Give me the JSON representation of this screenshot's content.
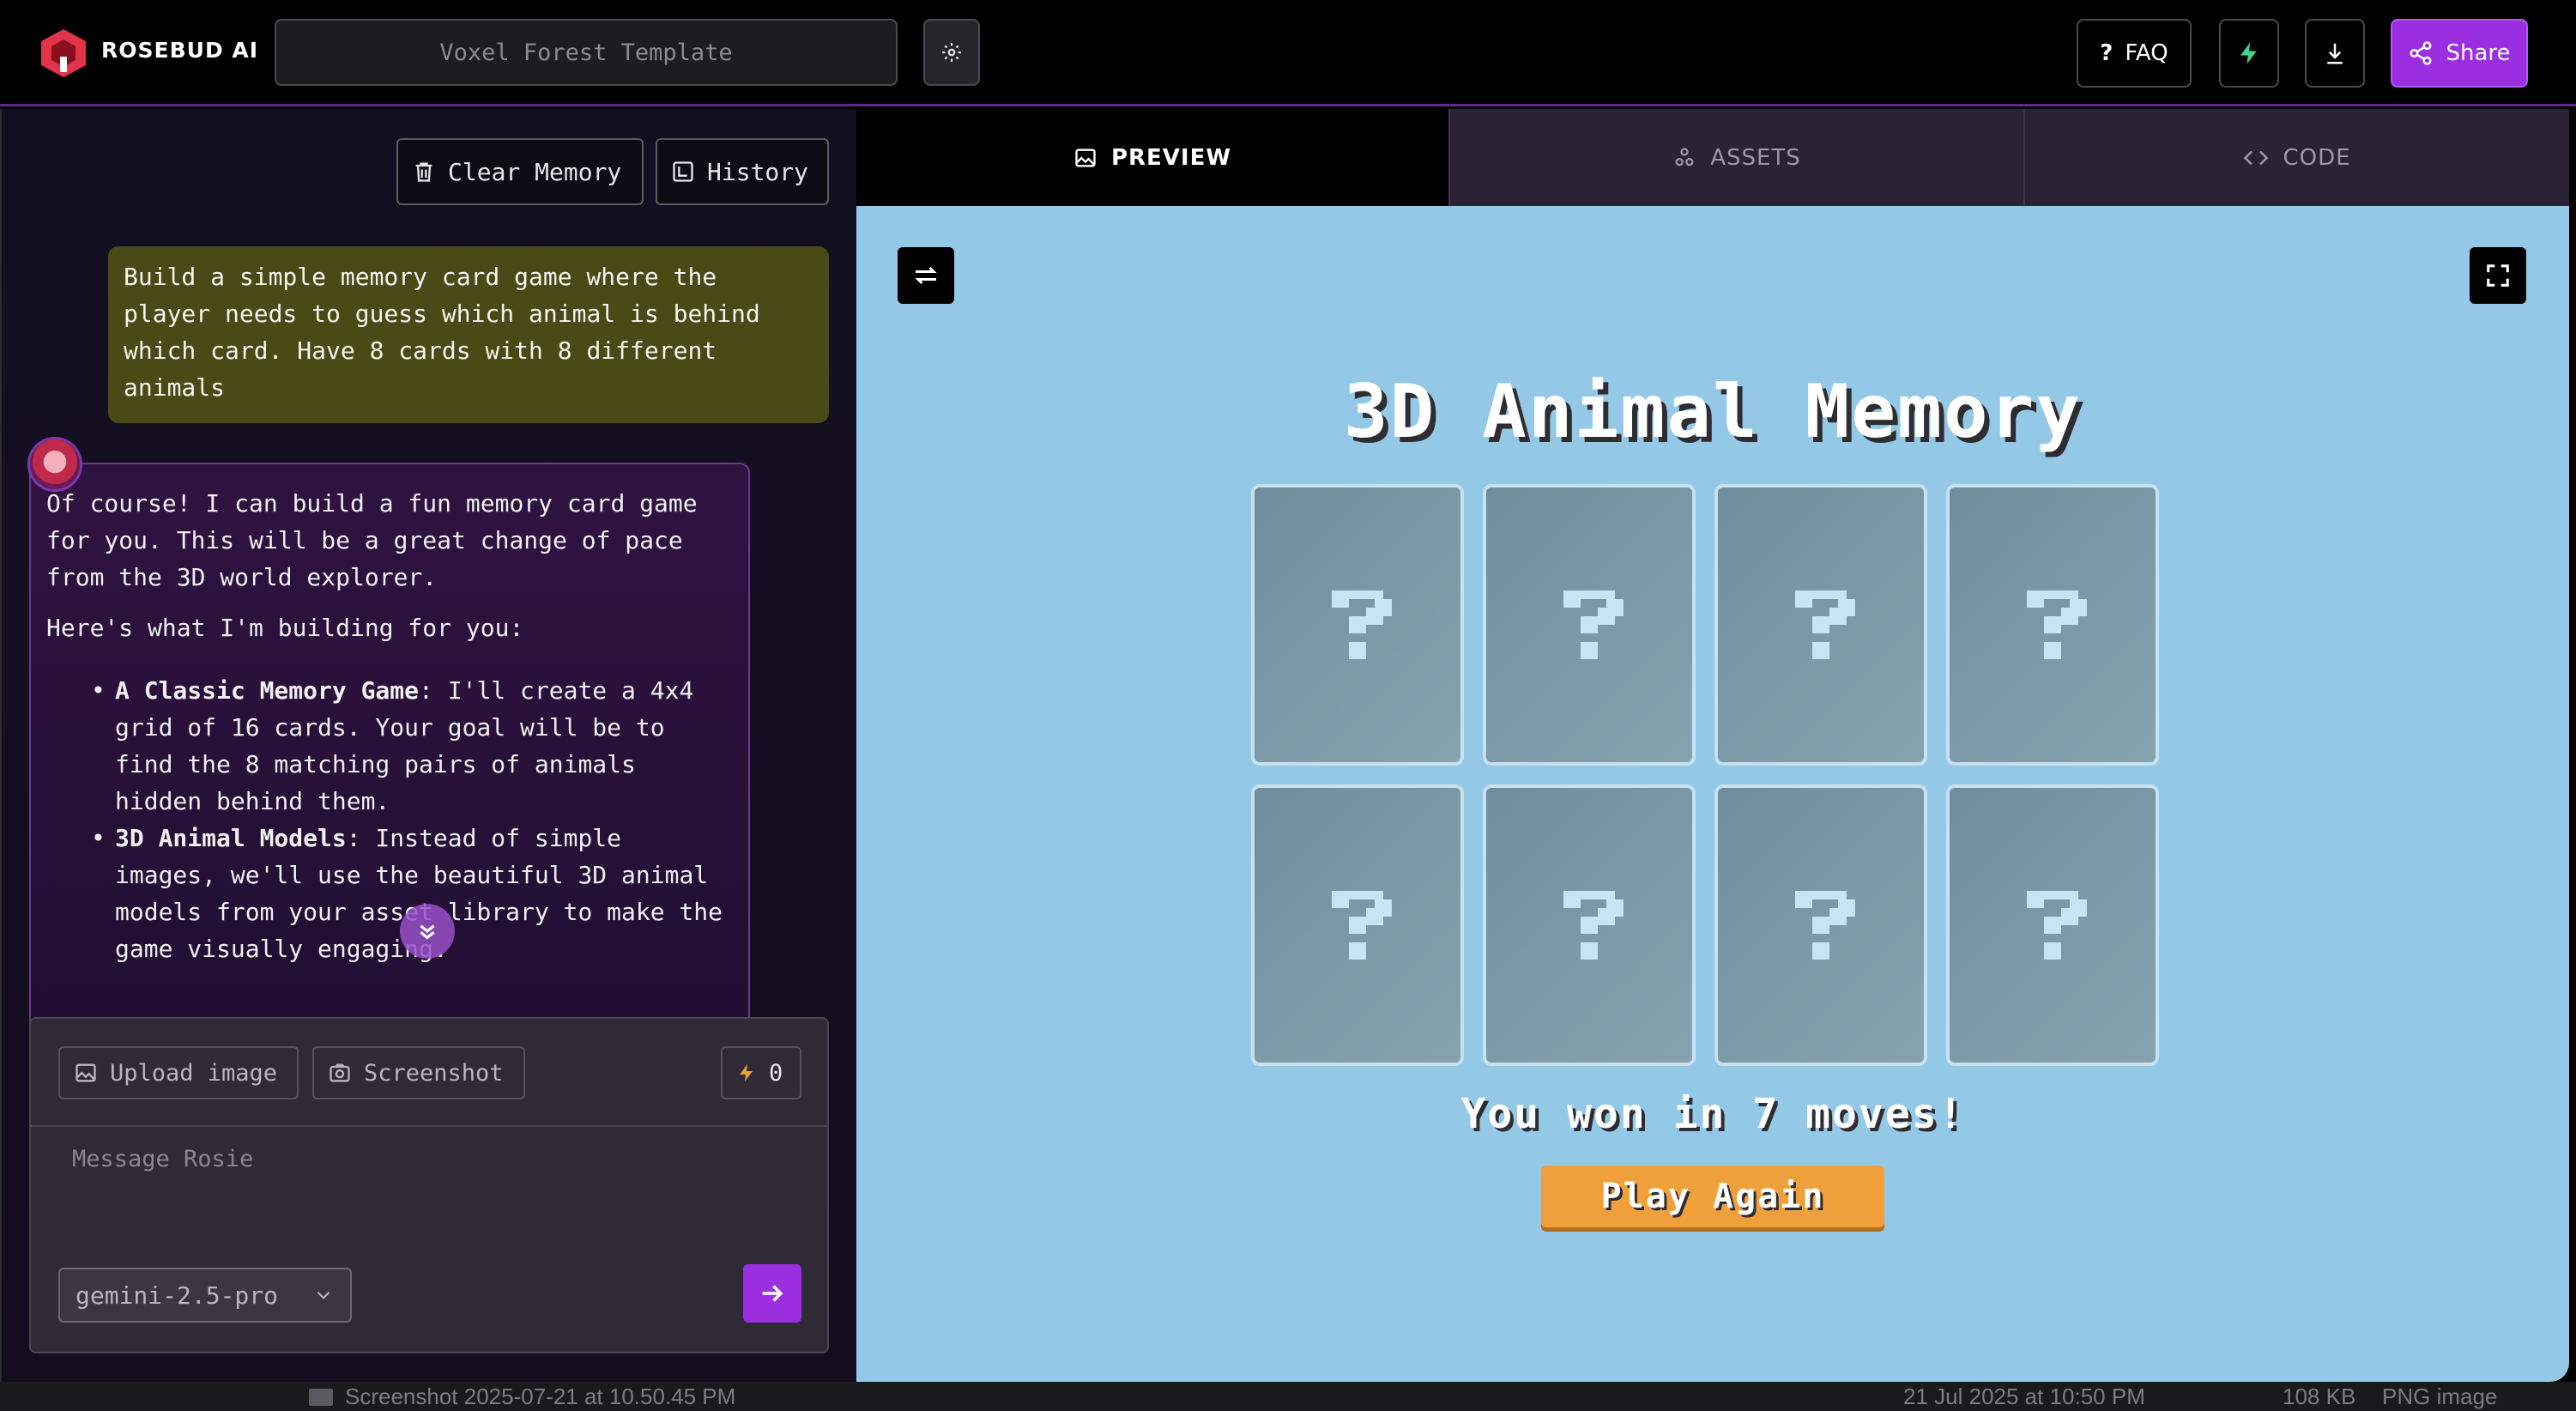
{
  "app": {
    "brand": "ROSEBUD AI",
    "project_title": "Voxel Forest Template"
  },
  "topbar": {
    "faq_label": "FAQ",
    "share_label": "Share"
  },
  "chat": {
    "clear_memory_label": "Clear Memory",
    "history_label": "History",
    "user_message": "Build a simple memory card game where the\nplayer needs to guess which animal is behind\nwhich card. Have 8 cards with 8 different\nanimals",
    "ai_intro": "Of course! I can build a fun memory card game for you. This will be a great change of pace from the 3D world explorer.",
    "ai_lead": "Here's what I'm building for you:",
    "ai_bullets": [
      {
        "title": "A Classic Memory Game",
        "text": ": I'll create a 4x4 grid of 16 cards. Your goal will be to find the 8 matching pairs of animals hidden behind them."
      },
      {
        "title": "3D Animal Models",
        "text": ": Instead of simple images, we'll use the beautiful 3D animal models from your asset library to make the game visually engaging."
      }
    ]
  },
  "composer": {
    "upload_label": "Upload image",
    "screenshot_label": "Screenshot",
    "credits": "0",
    "placeholder": "Message Rosie",
    "model": "gemini-2.5-pro"
  },
  "tabs": [
    {
      "label": "PREVIEW",
      "active": true
    },
    {
      "label": "ASSETS",
      "active": false
    },
    {
      "label": "CODE",
      "active": false
    }
  ],
  "game": {
    "title": "3D Animal Memory",
    "card_count": 8,
    "status": "You won in 7 moves!",
    "play_again_label": "Play Again"
  },
  "finder_strip": {
    "filename": "Screenshot 2025-07-21 at 10.50.45 PM",
    "date": "21 Jul 2025 at 10:50 PM",
    "size": "108 KB",
    "kind": "PNG image"
  },
  "colors": {
    "accent": "#9a2ee0",
    "preview_bg": "#93c9e6",
    "card": "#7a97a5",
    "play_button": "#f0a03a"
  }
}
